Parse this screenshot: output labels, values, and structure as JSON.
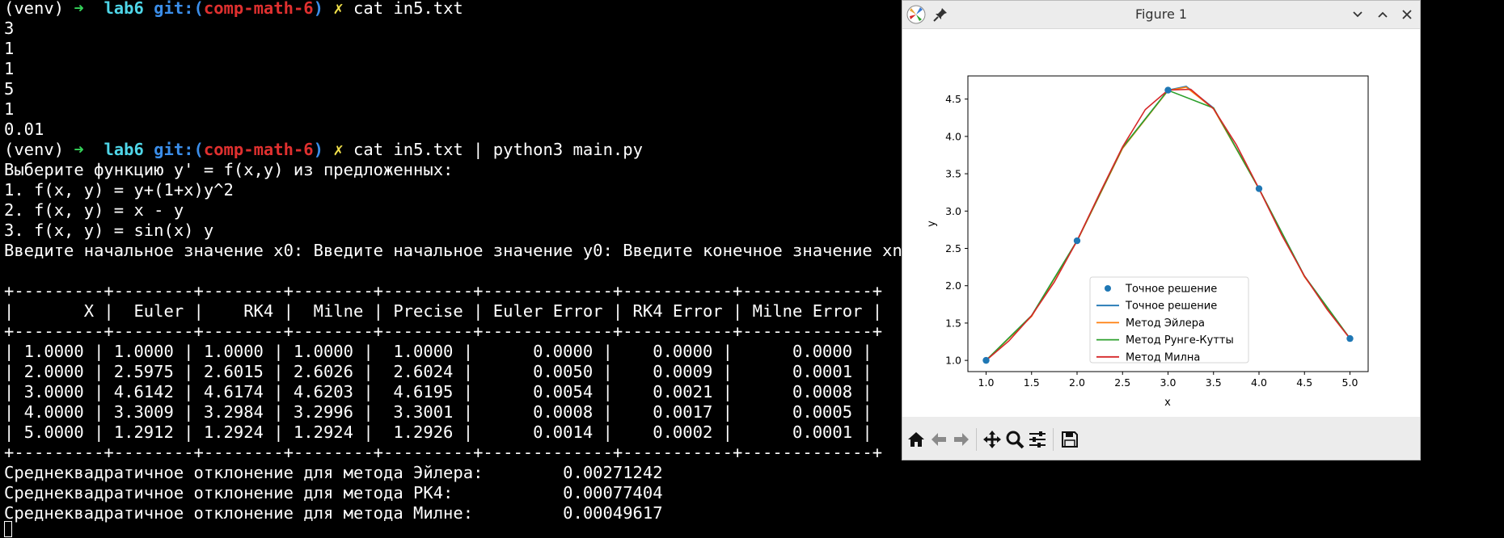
{
  "terminal": {
    "prompt1": {
      "env": "(venv)",
      "arrow": "➜",
      "dir": "lab6",
      "git_label": "git:(",
      "branch": "comp-math-6",
      "git_close": ")",
      "dirty": "✗",
      "command": "cat in5.txt"
    },
    "file_lines": [
      "3",
      "1",
      "1",
      "5",
      "1",
      "0.01"
    ],
    "prompt2": {
      "env": "(venv)",
      "arrow": "➜",
      "dir": "lab6",
      "git_label": "git:(",
      "branch": "comp-math-6",
      "git_close": ")",
      "dirty": "✗",
      "command": "cat in5.txt | python3 main.py"
    },
    "menu_lines": [
      "Выберите функцию y' = f(x,y) из предложенных:",
      "1. f(x, y) = y+(1+x)y^2",
      "2. f(x, y) = x - y",
      "3. f(x, y) = sin(x) y"
    ],
    "input_line": "Введите начальное значение x0: Введите начальное значение y0: Введите конечное значение xn: Введите шаг h: Введите точность eps:",
    "table_border": "+---------+--------+--------+--------+---------+-------------+-----------+-------------+",
    "table_header": "|       X |  Euler |    RK4 |  Milne | Precise | Euler Error | RK4 Error | Milne Error |",
    "table_rows": [
      "| 1.0000 | 1.0000 | 1.0000 | 1.0000 |  1.0000 |      0.0000 |    0.0000 |      0.0000 |",
      "| 2.0000 | 2.5975 | 2.6015 | 2.6026 |  2.6024 |      0.0050 |    0.0009 |      0.0001 |",
      "| 3.0000 | 4.6142 | 4.6174 | 4.6203 |  4.6195 |      0.0054 |    0.0021 |      0.0008 |",
      "| 4.0000 | 3.3009 | 3.2984 | 3.2996 |  3.3001 |      0.0008 |    0.0017 |      0.0005 |",
      "| 5.0000 | 1.2912 | 1.2924 | 1.2924 |  1.2926 |      0.0014 |    0.0002 |      0.0001 |"
    ],
    "summary_lines": [
      "Среднеквадратичное отклонение для метода Эйлера:        0.00271242",
      "Среднеквадратичное отклонение для метода РК4:           0.00077404",
      "Среднеквадратичное отклонение для метода Милне:         0.00049617"
    ]
  },
  "figure": {
    "title": "Figure 1",
    "colors": {
      "precise_points": "#1f77b4",
      "precise_line": "#1f77b4",
      "euler": "#ff7f0e",
      "rk": "#2ca02c",
      "milne": "#d62728"
    },
    "toolbar_icons": [
      "home-icon",
      "back-icon",
      "forward-icon",
      "pan-icon",
      "zoom-icon",
      "configure-icon",
      "save-icon"
    ]
  },
  "chart_data": {
    "type": "line",
    "title": "",
    "xlabel": "x",
    "ylabel": "y",
    "xlim": [
      0.8,
      5.2
    ],
    "ylim": [
      0.85,
      4.81
    ],
    "xticks": [
      "1.0",
      "1.5",
      "2.0",
      "2.5",
      "3.0",
      "3.5",
      "4.0",
      "4.5",
      "5.0"
    ],
    "yticks": [
      "1.0",
      "1.5",
      "2.0",
      "2.5",
      "3.0",
      "3.5",
      "4.0",
      "4.5"
    ],
    "legend_position": "lower-center",
    "grid": false,
    "series": [
      {
        "name": "Точное решение",
        "kind": "scatter",
        "x": [
          1,
          2,
          3,
          4,
          5
        ],
        "y": [
          1.0,
          2.6024,
          4.6195,
          3.3001,
          1.2926
        ]
      },
      {
        "name": "Точное решение",
        "kind": "line",
        "x": [
          1,
          1.5,
          2,
          2.5,
          3,
          3.2,
          3.5,
          4,
          4.5,
          5
        ],
        "y": [
          1.0,
          1.6,
          2.6024,
          3.85,
          4.6195,
          4.67,
          4.38,
          3.3001,
          2.13,
          1.2926
        ]
      },
      {
        "name": "Метод Эйлера",
        "kind": "line",
        "x": [
          1,
          1.5,
          2,
          2.5,
          3,
          3.2,
          3.5,
          4,
          4.5,
          5
        ],
        "y": [
          1.0,
          1.59,
          2.5975,
          3.84,
          4.6142,
          4.66,
          4.37,
          3.3009,
          2.12,
          1.2912
        ]
      },
      {
        "name": "Метод Рунге-Кутты",
        "kind": "line",
        "x": [
          1,
          1.5,
          2,
          2.5,
          3,
          3.5,
          4,
          4.5,
          5
        ],
        "y": [
          1.0,
          1.6,
          2.6015,
          3.85,
          4.6174,
          4.38,
          3.2984,
          2.13,
          1.2924
        ]
      },
      {
        "name": "Метод Милна",
        "kind": "line",
        "x": [
          1,
          1.25,
          1.5,
          1.75,
          2,
          2.25,
          2.5,
          2.75,
          3,
          3.25,
          3.5,
          3.75,
          4,
          4.25,
          4.5,
          4.75,
          5
        ],
        "y": [
          1.0,
          1.26,
          1.6,
          2.05,
          2.6026,
          3.24,
          3.86,
          4.36,
          4.6203,
          4.63,
          4.37,
          3.89,
          3.2996,
          2.68,
          2.13,
          1.68,
          1.2924
        ]
      }
    ]
  }
}
